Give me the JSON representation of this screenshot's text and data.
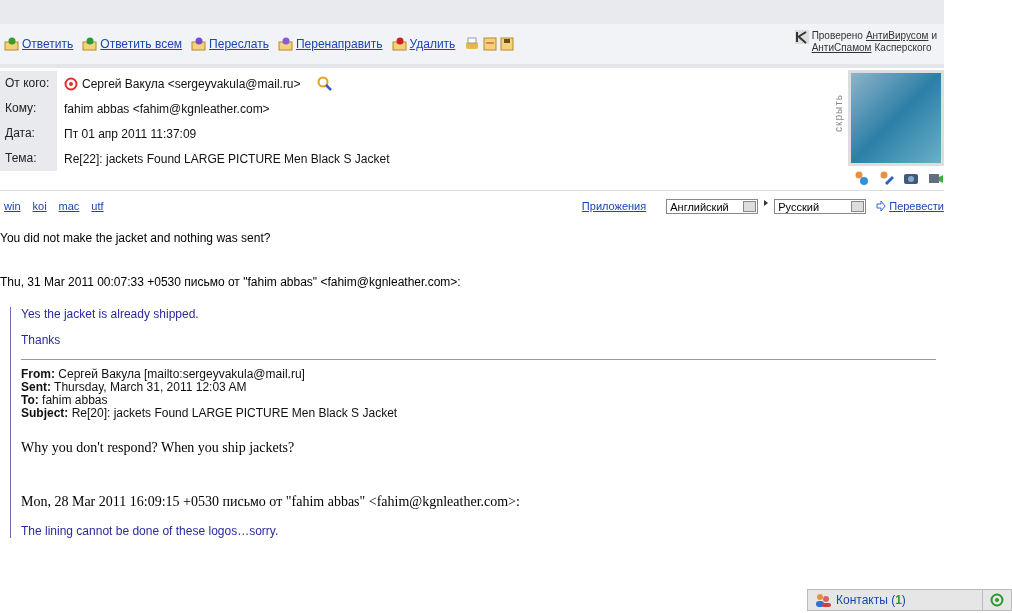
{
  "toolbar": {
    "actions": [
      {
        "label": "Ответить",
        "kind": "reply"
      },
      {
        "label": "Ответить всем",
        "kind": "reply-all"
      },
      {
        "label": "Переслать",
        "kind": "forward"
      },
      {
        "label": "Перенаправить",
        "kind": "redirect"
      },
      {
        "label": "Удалить",
        "kind": "delete"
      }
    ],
    "antivirus": {
      "prefix": "Проверено",
      "link_1": "АнтиВирусом",
      "middle": "и",
      "link_2": "АнтиСпамом",
      "suffix": "Касперского"
    }
  },
  "headers": [
    {
      "label": "От кого:",
      "value": "Сергей Вакула <sergeyvakula@mail.ru>",
      "kind": "sender"
    },
    {
      "label": "Кому:",
      "value": "fahim abbas <fahim@kgnleather.com>",
      "kind": "plain"
    },
    {
      "label": "Дата:",
      "value": "Пт 01 апр 2011 11:37:09",
      "kind": "plain"
    },
    {
      "label": "Тема:",
      "value": "Re[22]: jackets Found LARGE PICTURE Men Black S Jacket",
      "kind": "plain"
    }
  ],
  "hide_label": "скрыть",
  "encodings": [
    "win",
    "koi",
    "mac",
    "utf"
  ],
  "attachments_link": "Приложения",
  "translate": {
    "from": "Английский",
    "to": "Русский",
    "button": "Перевести"
  },
  "message": {
    "text": "You did not make the jacket and nothing was sent?",
    "quote_header": "Thu, 31 Mar 2011 00:07:33 +0530 письмо от \"fahim abbas\" <fahim@kgnleather.com>:",
    "quote_lines": [
      "Yes the jacket is already shipped.",
      "Thanks"
    ],
    "forward_fields": [
      "**From:** Сергей Вакула [mailto:sergeyvakula@mail.ru]",
      "**Sent:** Thursday, March 31, 2011 12:03 AM",
      "**To:** fahim abbas",
      "**Subject:** Re[20]: jackets Found LARGE PICTURE Men Black S Jacket"
    ],
    "inner_text": "Why you don't respond? When you ship jackets?",
    "inner_quote_header": "Mon, 28 Mar 2011 16:09:15 +0530 письмо от \"fahim abbas\" <fahim@kgnleather.com>:",
    "inner_quote_line": "The lining cannot be done of these logos…sorry."
  },
  "contacts": {
    "label": "Контакты (**1**)"
  }
}
